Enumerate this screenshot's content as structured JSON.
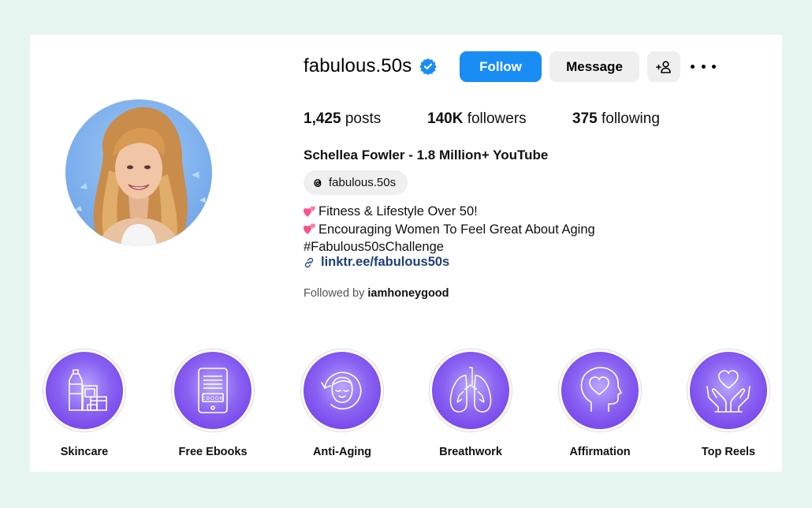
{
  "profile": {
    "username": "fabulous.50s",
    "verified": true,
    "follow_label": "Follow",
    "message_label": "Message",
    "add_user_icon": "add-user-icon",
    "more_icon": "more-horizontal-icon"
  },
  "stats": {
    "posts_count": "1,425",
    "posts_label": " posts",
    "followers_count": "140K",
    "followers_label": " followers",
    "following_count": "375",
    "following_label": " following"
  },
  "bio": {
    "full_name": "Schellea Fowler - 1.8 Million+ YouTube",
    "threads_handle": "fabulous.50s",
    "line1": "Fitness & Lifestyle Over 50!",
    "line2": "Encouraging Women To Feel Great About Aging",
    "line3": "#Fabulous50sChallenge",
    "link": "linktr.ee/fabulous50s",
    "followed_by_prefix": "Followed by ",
    "followed_by_user": "iamhoneygood"
  },
  "highlights": [
    {
      "label": "Skincare",
      "icon": "skincare-bottles-icon"
    },
    {
      "label": "Free Ebooks",
      "icon": "ebook-tablet-icon"
    },
    {
      "label": "Anti-Aging",
      "icon": "face-refresh-icon"
    },
    {
      "label": "Breathwork",
      "icon": "lungs-icon"
    },
    {
      "label": "Affirmation",
      "icon": "head-heart-icon"
    },
    {
      "label": "Top Reels",
      "icon": "hands-heart-icon"
    }
  ],
  "colors": {
    "page_background": "#e6f5ef",
    "follow_button": "#1a8df5",
    "highlight_purple": "#7b46ee",
    "link": "#1e3f7a",
    "verified_badge": "#1a8df5"
  }
}
